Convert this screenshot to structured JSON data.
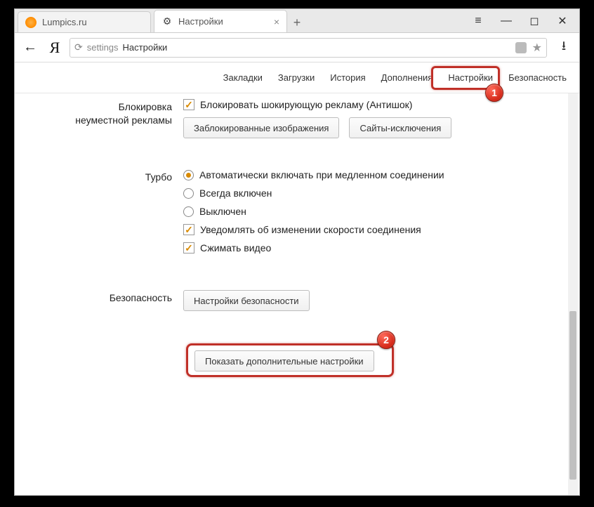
{
  "tabs": {
    "inactive_title": "Lumpics.ru",
    "active_title": "Настройки"
  },
  "url": {
    "prefix": "settings",
    "label": "Настройки"
  },
  "subnav": {
    "bookmarks": "Закладки",
    "downloads": "Загрузки",
    "history": "История",
    "addons": "Дополнения",
    "settings": "Настройки",
    "security": "Безопасность"
  },
  "markers": {
    "one": "1",
    "two": "2"
  },
  "adblock": {
    "section_label_l1": "Блокировка",
    "section_label_l2": "неуместной рекламы",
    "block_shock": "Блокировать шокирующую рекламу (Антишок)",
    "btn_blocked_images": "Заблокированные изображения",
    "btn_site_exceptions": "Сайты-исключения"
  },
  "turbo": {
    "section_label": "Турбо",
    "opt_auto": "Автоматически включать при медленном соединении",
    "opt_always": "Всегда включен",
    "opt_off": "Выключен",
    "chk_notify": "Уведомлять об изменении скорости соединения",
    "chk_compress": "Сжимать видео"
  },
  "security": {
    "section_label": "Безопасность",
    "btn_settings": "Настройки безопасности"
  },
  "advanced": {
    "btn_label": "Показать дополнительные настройки"
  },
  "ya_logo": "Я"
}
